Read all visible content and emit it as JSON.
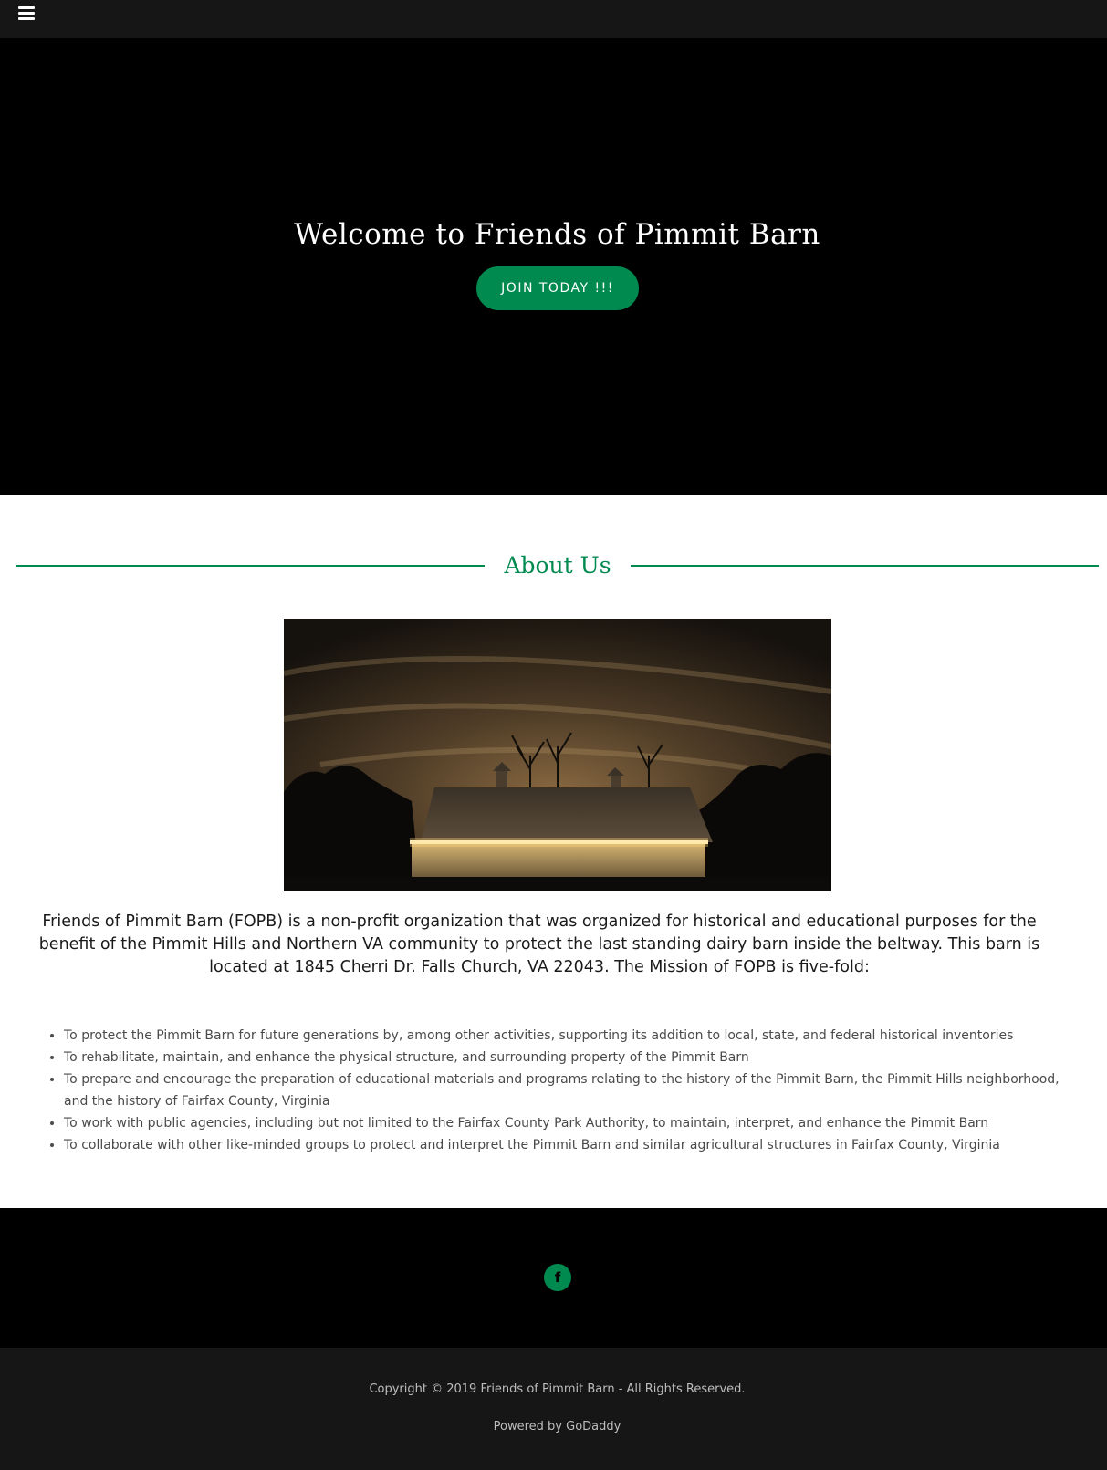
{
  "nav": {
    "menu_icon": "hamburger-menu-icon"
  },
  "hero": {
    "title": "Welcome to Friends of Pimmit Barn",
    "cta_label": "JOIN TODAY !!!",
    "cta_color": "#008a4f"
  },
  "about": {
    "heading": "About Us",
    "image_alt": "Pimmit Barn lit at night",
    "intro": "Friends of Pimmit Barn (FOPB) is a non-profit organization that was organized for historical and educational purposes for the benefit of the Pimmit Hills and Northern VA community to protect the last standing dairy barn inside the beltway. This barn is located at 1845 Cherri Dr. Falls Church, VA 22043. The Mission of FOPB is five-fold:",
    "mission": [
      "To protect the Pimmit Barn for future generations by, among other activities, supporting its addition to local, state, and federal historical inventories",
      "To rehabilitate, maintain, and enhance the physical structure, and surrounding property of the Pimmit Barn",
      "To prepare and encourage the preparation of educational materials and programs relating to the history of the Pimmit Barn, the Pimmit Hills neighborhood, and the history of Fairfax County, Virginia",
      "To work with public agencies, including but not limited to the Fairfax County Park Authority, to maintain, interpret, and enhance the Pimmit Barn",
      "To collaborate with other like-minded groups to protect and interpret the Pimmit Barn and similar agricultural structures in Fairfax County, Virginia"
    ]
  },
  "social": {
    "facebook_label": "f",
    "facebook_icon": "facebook-icon"
  },
  "footer": {
    "copyright": "Copyright © 2019 Friends of Pimmit Barn - All Rights Reserved.",
    "powered_prefix": "Powered by ",
    "powered_link": "GoDaddy"
  },
  "colors": {
    "accent": "#008a4f",
    "topbar": "#161616",
    "hero_bg": "#000000"
  }
}
